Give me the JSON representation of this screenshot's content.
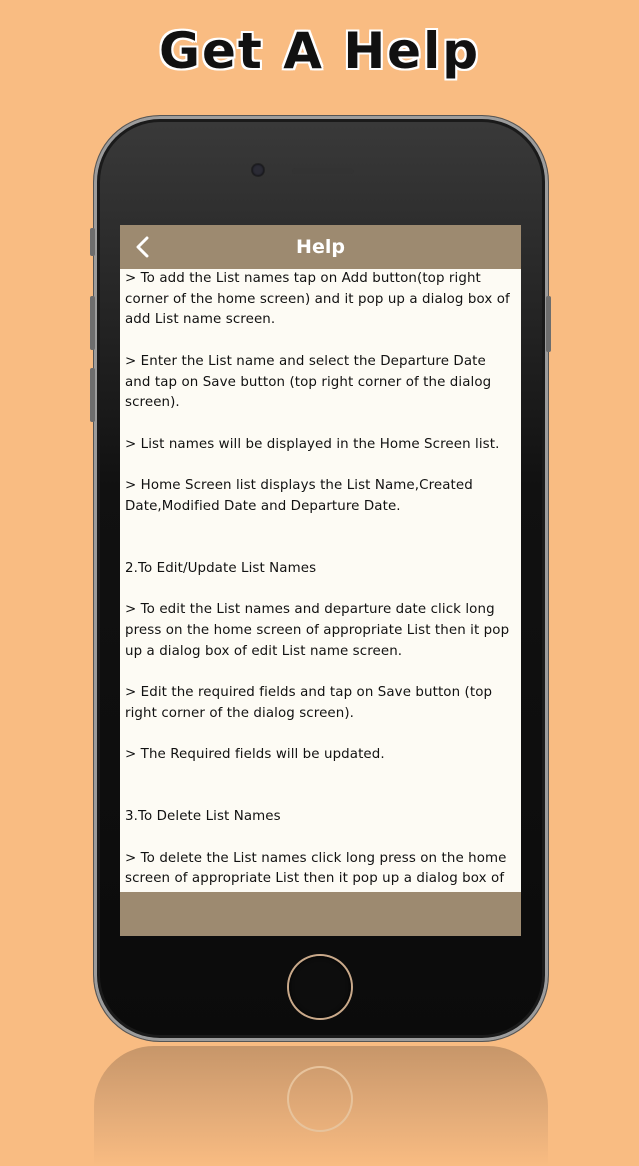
{
  "banner": {
    "title": "Get A Help"
  },
  "appbar": {
    "back_icon": "chevron-left-icon",
    "title": "Help"
  },
  "help": {
    "paragraphs": [
      "> To add the List names tap on Add button(top right corner of the home screen) and it pop up a dialog box of add List name screen.",
      "> Enter the List name and select the Departure Date and tap on Save button (top right corner of the dialog screen).",
      "> List names will be displayed in the Home Screen list.",
      "> Home Screen list displays the List Name,Created Date,Modified Date and Departure Date.",
      "2.To Edit/Update List Names",
      "> To edit the List names and departure date click long press on the home screen of appropriate List then it pop up a dialog box of edit List name screen.",
      "> Edit the required fields and tap on Save button (top right corner of the dialog screen).",
      "> The Required fields will be updated.",
      "3.To Delete List Names",
      "> To delete the List names click long press on the home screen of appropriate List then it pop up a dialog box of edit List name screen."
    ]
  },
  "colors": {
    "background": "#F9BC82",
    "appbar": "#9D8A70",
    "screen": "#FDFBF4"
  }
}
